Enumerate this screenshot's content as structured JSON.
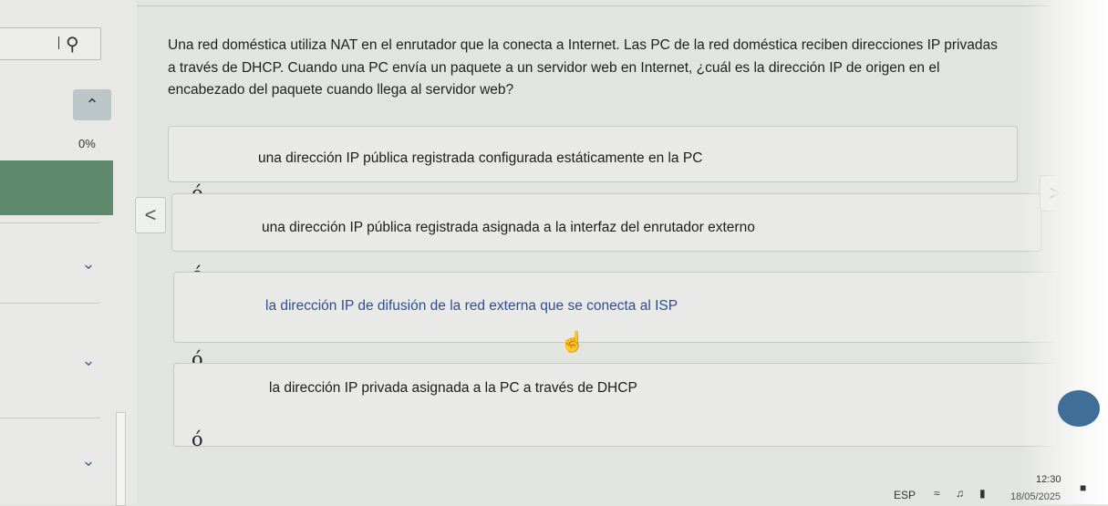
{
  "sidebar": {
    "progress": "0%",
    "progress_fraction": 0.0,
    "up_icon": "chevron-up-icon",
    "collapse_icon": "chevron-down-icon"
  },
  "question": {
    "text": "Una red doméstica utiliza NAT en el enrutador que la conecta a Internet. Las PC de la red doméstica reciben direcciones IP privadas a través de DHCP. Cuando una PC envía un paquete a un servidor web en Internet, ¿cuál es la dirección IP de origen en el encabezado del paquete cuando llega al servidor web?"
  },
  "options": [
    {
      "label": "una dirección IP pública registrada configurada estáticamente en la PC"
    },
    {
      "label": "una dirección IP pública registrada asignada a la interfaz del enrutador externo"
    },
    {
      "label": "la dirección IP de difusión de la red externa que se conecta al ISP"
    },
    {
      "label": "la dirección IP privada asignada a la PC a través de DHCP"
    }
  ],
  "separator": "ó",
  "nav": {
    "prev": "<",
    "next": ">"
  },
  "taskbar": {
    "language": "ESP",
    "time": "12:30",
    "date": "18/05/2025"
  },
  "colors": {
    "progress_fill": "#5e8a6b",
    "option_hover_text": "#2e4f8f",
    "chevron": "#4a6a8a"
  }
}
